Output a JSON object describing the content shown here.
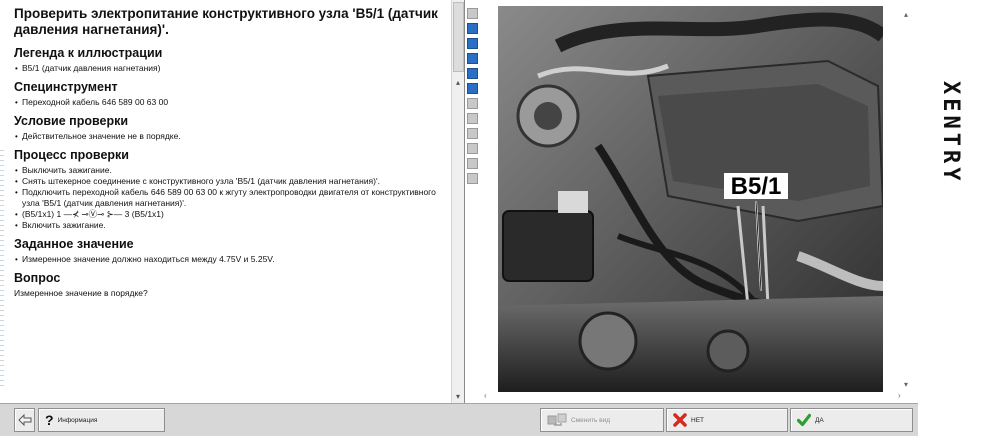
{
  "content": {
    "title": "Проверить электропитание конструктивного узла 'B5/1 (датчик давления нагнетания)'.",
    "sections": [
      {
        "heading": "Легенда к иллюстрации",
        "items": [
          "B5/1 (датчик давления нагнетания)"
        ]
      },
      {
        "heading": "Специнструмент",
        "items": [
          "Переходной кабель 646 589 00 63 00"
        ]
      },
      {
        "heading": "Условие проверки",
        "items": [
          "Действительное значение не в порядке."
        ]
      },
      {
        "heading": "Процесс проверки",
        "items": [
          "Выключить зажигание.",
          "Снять штекерное соединение с конструктивного узла 'B5/1 (датчик давления нагнетания)'.",
          "Подключить переходной кабель 646 589 00 63 00 к жгуту электропроводки двигателя от конструктивного узла 'B5/1 (датчик давления нагнетания)'.",
          "(B5/1x1) 1 —⊀ ⊸Ⓥ⊸ ⊱— 3 (B5/1x1)",
          "Включить зажигание."
        ]
      },
      {
        "heading": "Заданное значение",
        "items": [
          "Измеренное значение должно находиться между 4.75V и 5.25V."
        ]
      }
    ],
    "question": {
      "heading": "Вопрос",
      "text": "Измеренное значение в порядке?"
    }
  },
  "image": {
    "callout_label": "B5/1"
  },
  "brand": {
    "name": "XENTRY"
  },
  "bottom_bar": {
    "info_label": "Информация",
    "change_view_label": "Сменить вид",
    "no_label": "НЕТ",
    "yes_label": "ДА"
  },
  "colors": {
    "no": "#d12a1f",
    "yes": "#2e9e2e",
    "tool_blue": "#2a6fc4"
  },
  "icons": [
    "back-arrow-icon",
    "question-icon",
    "change-view-icon",
    "x-icon",
    "check-icon"
  ]
}
